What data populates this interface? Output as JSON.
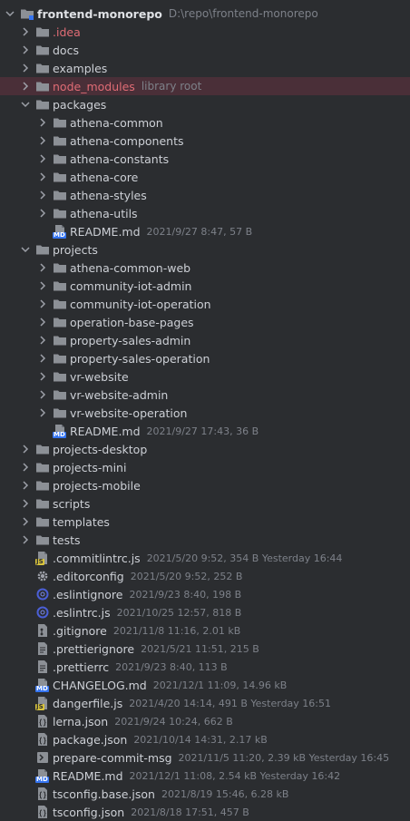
{
  "project": {
    "name": "frontend-monorepo",
    "path": "D:\\repo\\frontend-monorepo"
  },
  "items": [
    {
      "kind": "folder",
      "name": ".idea",
      "state": "collapsed",
      "depth": 1,
      "color": "#e06c75"
    },
    {
      "kind": "folder",
      "name": "docs",
      "state": "collapsed",
      "depth": 1
    },
    {
      "kind": "folder",
      "name": "examples",
      "state": "collapsed",
      "depth": 1
    },
    {
      "kind": "folder",
      "name": "node_modules",
      "hint": "library root",
      "state": "collapsed",
      "depth": 1,
      "excluded": true
    },
    {
      "kind": "folder",
      "name": "packages",
      "state": "expanded",
      "depth": 1
    },
    {
      "kind": "folder",
      "name": "athena-common",
      "state": "collapsed",
      "depth": 2
    },
    {
      "kind": "folder",
      "name": "athena-components",
      "state": "collapsed",
      "depth": 2
    },
    {
      "kind": "folder",
      "name": "athena-constants",
      "state": "collapsed",
      "depth": 2
    },
    {
      "kind": "folder",
      "name": "athena-core",
      "state": "collapsed",
      "depth": 2
    },
    {
      "kind": "folder",
      "name": "athena-styles",
      "state": "collapsed",
      "depth": 2
    },
    {
      "kind": "folder",
      "name": "athena-utils",
      "state": "collapsed",
      "depth": 2
    },
    {
      "kind": "file",
      "icon": "markdown-icon",
      "name": "README.md",
      "meta": "2021/9/27 8:47, 57 B",
      "depth": 2
    },
    {
      "kind": "folder",
      "name": "projects",
      "state": "expanded",
      "depth": 1
    },
    {
      "kind": "folder",
      "name": "athena-common-web",
      "state": "collapsed",
      "depth": 2
    },
    {
      "kind": "folder",
      "name": "community-iot-admin",
      "state": "collapsed",
      "depth": 2
    },
    {
      "kind": "folder",
      "name": "community-iot-operation",
      "state": "collapsed",
      "depth": 2
    },
    {
      "kind": "folder",
      "name": "operation-base-pages",
      "state": "collapsed",
      "depth": 2
    },
    {
      "kind": "folder",
      "name": "property-sales-admin",
      "state": "collapsed",
      "depth": 2
    },
    {
      "kind": "folder",
      "name": "property-sales-operation",
      "state": "collapsed",
      "depth": 2
    },
    {
      "kind": "folder",
      "name": "vr-website",
      "state": "collapsed",
      "depth": 2
    },
    {
      "kind": "folder",
      "name": "vr-website-admin",
      "state": "collapsed",
      "depth": 2
    },
    {
      "kind": "folder",
      "name": "vr-website-operation",
      "state": "collapsed",
      "depth": 2
    },
    {
      "kind": "file",
      "icon": "markdown-icon",
      "name": "README.md",
      "meta": "2021/9/27 17:43, 36 B",
      "depth": 2
    },
    {
      "kind": "folder",
      "name": "projects-desktop",
      "state": "collapsed",
      "depth": 1
    },
    {
      "kind": "folder",
      "name": "projects-mini",
      "state": "collapsed",
      "depth": 1
    },
    {
      "kind": "folder",
      "name": "projects-mobile",
      "state": "collapsed",
      "depth": 1
    },
    {
      "kind": "folder",
      "name": "scripts",
      "state": "collapsed",
      "depth": 1
    },
    {
      "kind": "folder",
      "name": "templates",
      "state": "collapsed",
      "depth": 1
    },
    {
      "kind": "folder",
      "name": "tests",
      "state": "collapsed",
      "depth": 1
    },
    {
      "kind": "file",
      "icon": "javascript-icon",
      "name": ".commitlintrc.js",
      "meta": "2021/5/20 9:52, 354 B Yesterday 16:44",
      "depth": 1
    },
    {
      "kind": "file",
      "icon": "gear-icon",
      "name": ".editorconfig",
      "meta": "2021/5/20 9:52, 252 B",
      "depth": 1
    },
    {
      "kind": "file",
      "icon": "eslint-icon",
      "name": ".eslintignore",
      "meta": "2021/9/23 8:40, 198 B",
      "depth": 1
    },
    {
      "kind": "file",
      "icon": "eslint-icon",
      "name": ".eslintrc.js",
      "meta": "2021/10/25 12:57, 818 B",
      "depth": 1
    },
    {
      "kind": "file",
      "icon": "git-icon",
      "name": ".gitignore",
      "meta": "2021/11/8 11:16, 2.01 kB",
      "depth": 1
    },
    {
      "kind": "file",
      "icon": "text-file-icon",
      "name": ".prettierignore",
      "meta": "2021/5/21 11:51, 215 B",
      "depth": 1
    },
    {
      "kind": "file",
      "icon": "text-file-icon",
      "name": ".prettierrc",
      "meta": "2021/9/23 8:40, 113 B",
      "depth": 1
    },
    {
      "kind": "file",
      "icon": "markdown-icon",
      "name": "CHANGELOG.md",
      "meta": "2021/12/1 11:09, 14.96 kB",
      "depth": 1
    },
    {
      "kind": "file",
      "icon": "javascript-icon",
      "name": "dangerfile.js",
      "meta": "2021/4/20 14:14, 491 B Yesterday 16:51",
      "depth": 1
    },
    {
      "kind": "file",
      "icon": "json-icon",
      "name": "lerna.json",
      "meta": "2021/9/24 10:24, 662 B",
      "depth": 1
    },
    {
      "kind": "file",
      "icon": "json-icon",
      "name": "package.json",
      "meta": "2021/10/14 14:31, 2.17 kB",
      "depth": 1
    },
    {
      "kind": "file",
      "icon": "script-icon",
      "name": "prepare-commit-msg",
      "meta": "2021/11/5 11:20, 2.39 kB Yesterday 16:45",
      "depth": 1
    },
    {
      "kind": "file",
      "icon": "markdown-icon",
      "name": "README.md",
      "meta": "2021/12/1 11:08, 2.54 kB Yesterday 16:42",
      "depth": 1
    },
    {
      "kind": "file",
      "icon": "json-icon",
      "name": "tsconfig.base.json",
      "meta": "2021/8/19 15:46, 6.28 kB",
      "depth": 1
    },
    {
      "kind": "file",
      "icon": "json-icon",
      "name": "tsconfig.json",
      "meta": "2021/8/18 17:51, 457 B",
      "depth": 1
    }
  ],
  "colors": {
    "background": "#2b2d30",
    "text": "#cdd0d6",
    "meta": "#7d8189",
    "folder": "#8c9096",
    "excluded_row": "#4a2f38",
    "excluded_text": "#e06c75",
    "markdown_badge": "#3574f0",
    "js_badge": "#d9c43c",
    "eslint": "#4b5fd6"
  }
}
